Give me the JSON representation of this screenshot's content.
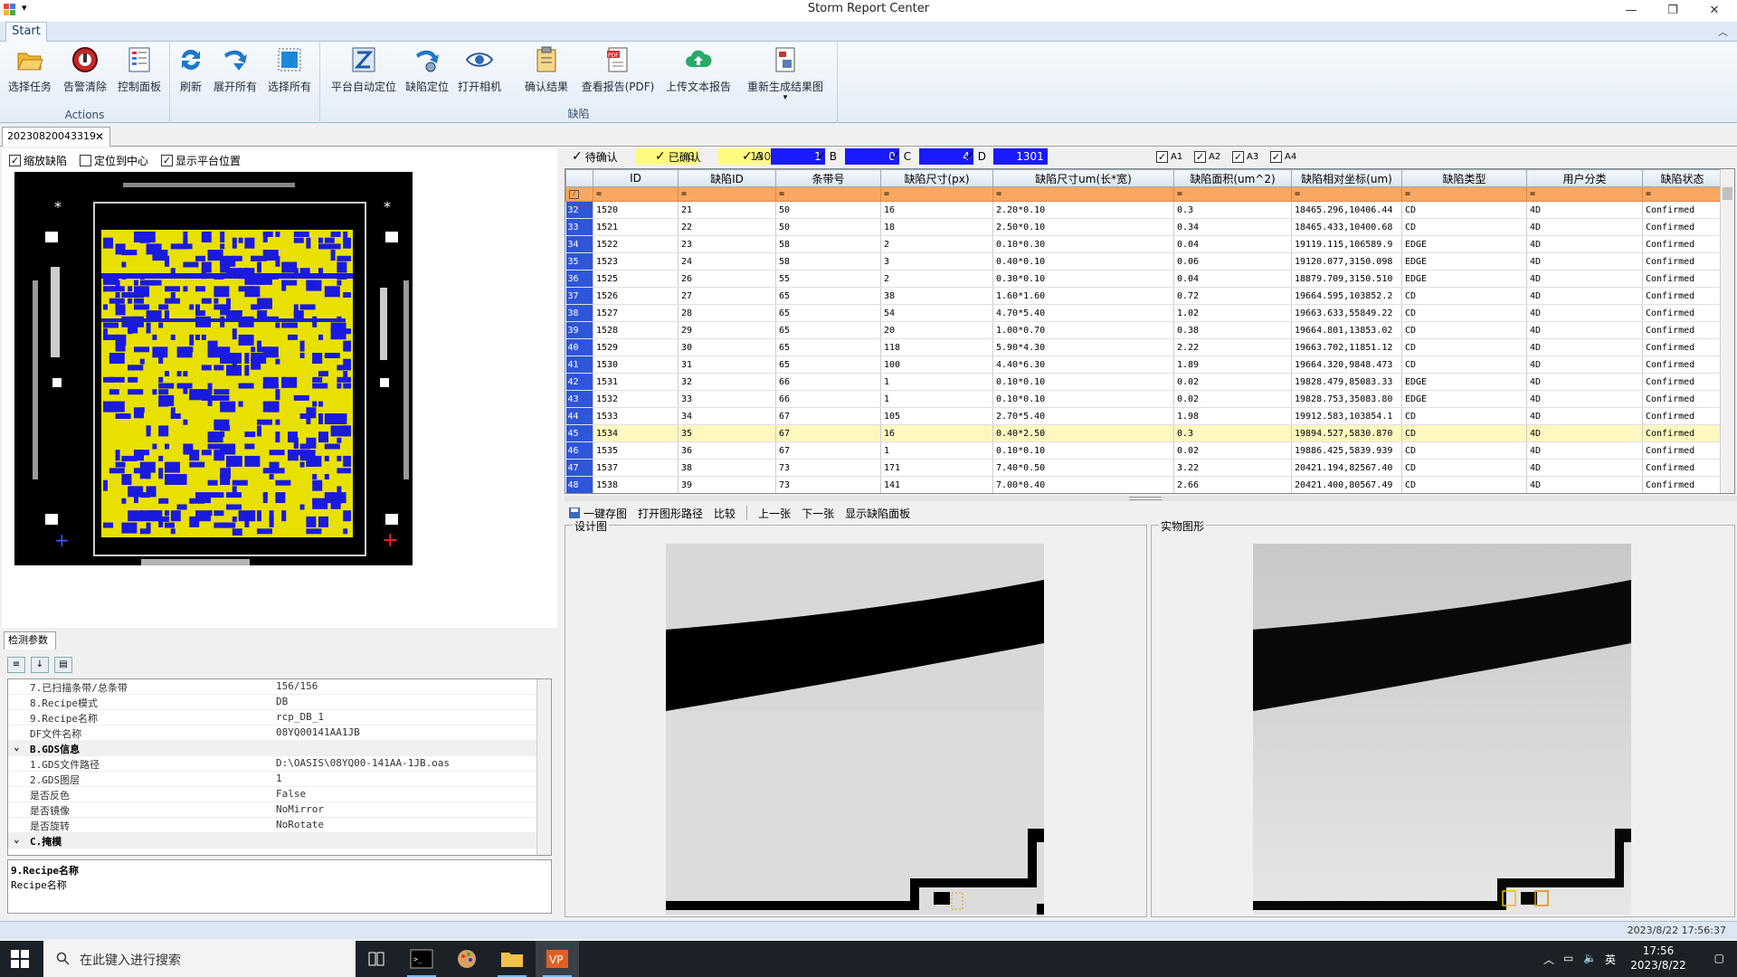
{
  "window": {
    "title": "Storm Report Center",
    "quick_access": "▾",
    "minimize": "—",
    "restore": "❐",
    "close": "✕"
  },
  "ribbon": {
    "tab": "Start",
    "collapse": "︿",
    "groups": [
      {
        "label": "Actions",
        "buttons": [
          {
            "label": "选择任务",
            "icon": "folder-open-icon"
          },
          {
            "label": "告警清除",
            "icon": "alarm-clear-icon"
          },
          {
            "label": "控制面板",
            "icon": "control-panel-icon"
          }
        ]
      },
      {
        "label": "",
        "buttons": [
          {
            "label": "刷新",
            "icon": "refresh-icon"
          },
          {
            "label": "展开所有",
            "icon": "expand-all-icon"
          },
          {
            "label": "选择所有",
            "icon": "select-all-icon"
          }
        ]
      },
      {
        "label": "缺陷",
        "buttons": [
          {
            "label": "平台自动定位",
            "icon": "auto-locate-icon"
          },
          {
            "label": "缺陷定位",
            "icon": "defect-locate-icon"
          },
          {
            "label": "打开相机",
            "icon": "camera-eye-icon"
          },
          {
            "label": "确认结果",
            "icon": "clipboard-icon"
          },
          {
            "label": "查看报告(PDF)",
            "icon": "pdf-report-icon"
          },
          {
            "label": "上传文本报告",
            "icon": "cloud-upload-icon"
          },
          {
            "label": "重新生成结果图",
            "icon": "regenerate-icon",
            "extra": "▾"
          }
        ]
      }
    ]
  },
  "doc_tab": {
    "label": "20230820043319",
    "close": "✕"
  },
  "left": {
    "checkboxes": [
      {
        "label": "缩放缺陷",
        "checked": true
      },
      {
        "label": "定位到中心",
        "checked": false
      },
      {
        "label": "显示平台位置",
        "checked": true
      }
    ]
  },
  "props": {
    "tab": "检测参数",
    "rows": [
      {
        "type": "prop",
        "name": "7.已扫描条带/总条带",
        "value": "156/156"
      },
      {
        "type": "prop",
        "name": "8.Recipe模式",
        "value": "DB"
      },
      {
        "type": "prop",
        "name": "9.Recipe名称",
        "value": "rcp_DB_1"
      },
      {
        "type": "prop",
        "name": "DF文件名称",
        "value": "08YQ00141AA1JB"
      },
      {
        "type": "cat",
        "name": "B.GDS信息",
        "value": ""
      },
      {
        "type": "prop",
        "name": "1.GDS文件路径",
        "value": "D:\\OASIS\\08YQ00-141AA-1JB.oas"
      },
      {
        "type": "prop",
        "name": "2.GDS图层",
        "value": "1"
      },
      {
        "type": "prop",
        "name": "是否反色",
        "value": "False"
      },
      {
        "type": "prop",
        "name": "是否镜像",
        "value": "NoMirror"
      },
      {
        "type": "prop",
        "name": "是否旋转",
        "value": "NoRotate"
      },
      {
        "type": "cat",
        "name": "C.掩模",
        "value": ""
      }
    ],
    "desc_title": "9.Recipe名称",
    "desc_text": "Recipe名称"
  },
  "filters": [
    {
      "label": "待确认",
      "value": "0",
      "color": "#fffb80"
    },
    {
      "label": "已确认",
      "value": "1306",
      "color": "#fffb80"
    },
    {
      "label": "A",
      "value": "1",
      "color": "#1a1aff"
    },
    {
      "label": "B",
      "value": "0",
      "color": "#1a1aff"
    },
    {
      "label": "C",
      "value": "4",
      "color": "#1a1aff"
    },
    {
      "label": "D",
      "value": "1301",
      "color": "#1a1aff"
    }
  ],
  "layers": [
    "A1",
    "A2",
    "A3",
    "A4"
  ],
  "table": {
    "columns": [
      "",
      "ID",
      "缺陷ID",
      "条带号",
      "缺陷尺寸(px)",
      "缺陷尺寸um(长*宽)",
      "缺陷面积(um^2)",
      "缺陷相对坐标(um)",
      "缺陷类型",
      "用户分类",
      "缺陷状态"
    ],
    "filter_symbol": "=",
    "rows": [
      [
        "32",
        "1520",
        "21",
        "50",
        "16",
        "2.20*0.10",
        "0.3",
        "18465.296,10406.44",
        "CD",
        "4D",
        "Confirmed"
      ],
      [
        "33",
        "1521",
        "22",
        "50",
        "18",
        "2.50*0.10",
        "0.34",
        "18465.433,10400.68",
        "CD",
        "4D",
        "Confirmed"
      ],
      [
        "34",
        "1522",
        "23",
        "58",
        "2",
        "0.10*0.30",
        "0.04",
        "19119.115,106589.9",
        "EDGE",
        "4D",
        "Confirmed"
      ],
      [
        "35",
        "1523",
        "24",
        "58",
        "3",
        "0.40*0.10",
        "0.06",
        "19120.077,3150.098",
        "EDGE",
        "4D",
        "Confirmed"
      ],
      [
        "36",
        "1525",
        "26",
        "55",
        "2",
        "0.30*0.10",
        "0.04",
        "18879.709,3150.510",
        "EDGE",
        "4D",
        "Confirmed"
      ],
      [
        "37",
        "1526",
        "27",
        "65",
        "38",
        "1.60*1.60",
        "0.72",
        "19664.595,103852.2",
        "CD",
        "4D",
        "Confirmed"
      ],
      [
        "38",
        "1527",
        "28",
        "65",
        "54",
        "4.70*5.40",
        "1.02",
        "19663.633,55849.22",
        "CD",
        "4D",
        "Confirmed"
      ],
      [
        "39",
        "1528",
        "29",
        "65",
        "20",
        "1.00*0.70",
        "0.38",
        "19664.801,13853.02",
        "CD",
        "4D",
        "Confirmed"
      ],
      [
        "40",
        "1529",
        "30",
        "65",
        "118",
        "5.90*4.30",
        "2.22",
        "19663.702,11851.12",
        "CD",
        "4D",
        "Confirmed"
      ],
      [
        "41",
        "1530",
        "31",
        "65",
        "100",
        "4.40*6.30",
        "1.89",
        "19664.320,9848.473",
        "CD",
        "4D",
        "Confirmed"
      ],
      [
        "42",
        "1531",
        "32",
        "66",
        "1",
        "0.10*0.10",
        "0.02",
        "19828.479,85083.33",
        "EDGE",
        "4D",
        "Confirmed"
      ],
      [
        "43",
        "1532",
        "33",
        "66",
        "1",
        "0.10*0.10",
        "0.02",
        "19828.753,35083.80",
        "EDGE",
        "4D",
        "Confirmed"
      ],
      [
        "44",
        "1533",
        "34",
        "67",
        "105",
        "2.70*5.40",
        "1.98",
        "19912.583,103854.1",
        "CD",
        "4D",
        "Confirmed"
      ],
      [
        "45",
        "1534",
        "35",
        "67",
        "16",
        "0.40*2.50",
        "0.3",
        "19894.527,5830.870",
        "CD",
        "4D",
        "Confirmed"
      ],
      [
        "46",
        "1535",
        "36",
        "67",
        "1",
        "0.10*0.10",
        "0.02",
        "19886.425,5839.939",
        "CD",
        "4D",
        "Confirmed"
      ],
      [
        "47",
        "1537",
        "38",
        "73",
        "171",
        "7.40*0.50",
        "3.22",
        "20421.194,82567.40",
        "CD",
        "4D",
        "Confirmed"
      ],
      [
        "48",
        "1538",
        "39",
        "73",
        "141",
        "7.00*0.40",
        "2.66",
        "20421.400,80567.49",
        "CD",
        "4D",
        "Confirmed"
      ]
    ],
    "selected_index": 13
  },
  "image_toolbar": [
    "一键存图",
    "打开图形路径",
    "比较",
    "上一张",
    "下一张",
    "显示缺陷面板"
  ],
  "panels": {
    "design": "设计图",
    "real": "实物图形"
  },
  "status": {
    "datetime": "2023/8/22 17:56:37"
  },
  "taskbar": {
    "search_placeholder": "在此键入进行搜索",
    "time": "17:56",
    "date": "2023/8/22",
    "ime": "英"
  },
  "colors": {
    "accent": "#2f56d8",
    "selected_row": "#fff7c0",
    "filter_row": "#f8a860",
    "wafer_yellow": "#e8e000",
    "wafer_blue": "#1a1adf"
  }
}
